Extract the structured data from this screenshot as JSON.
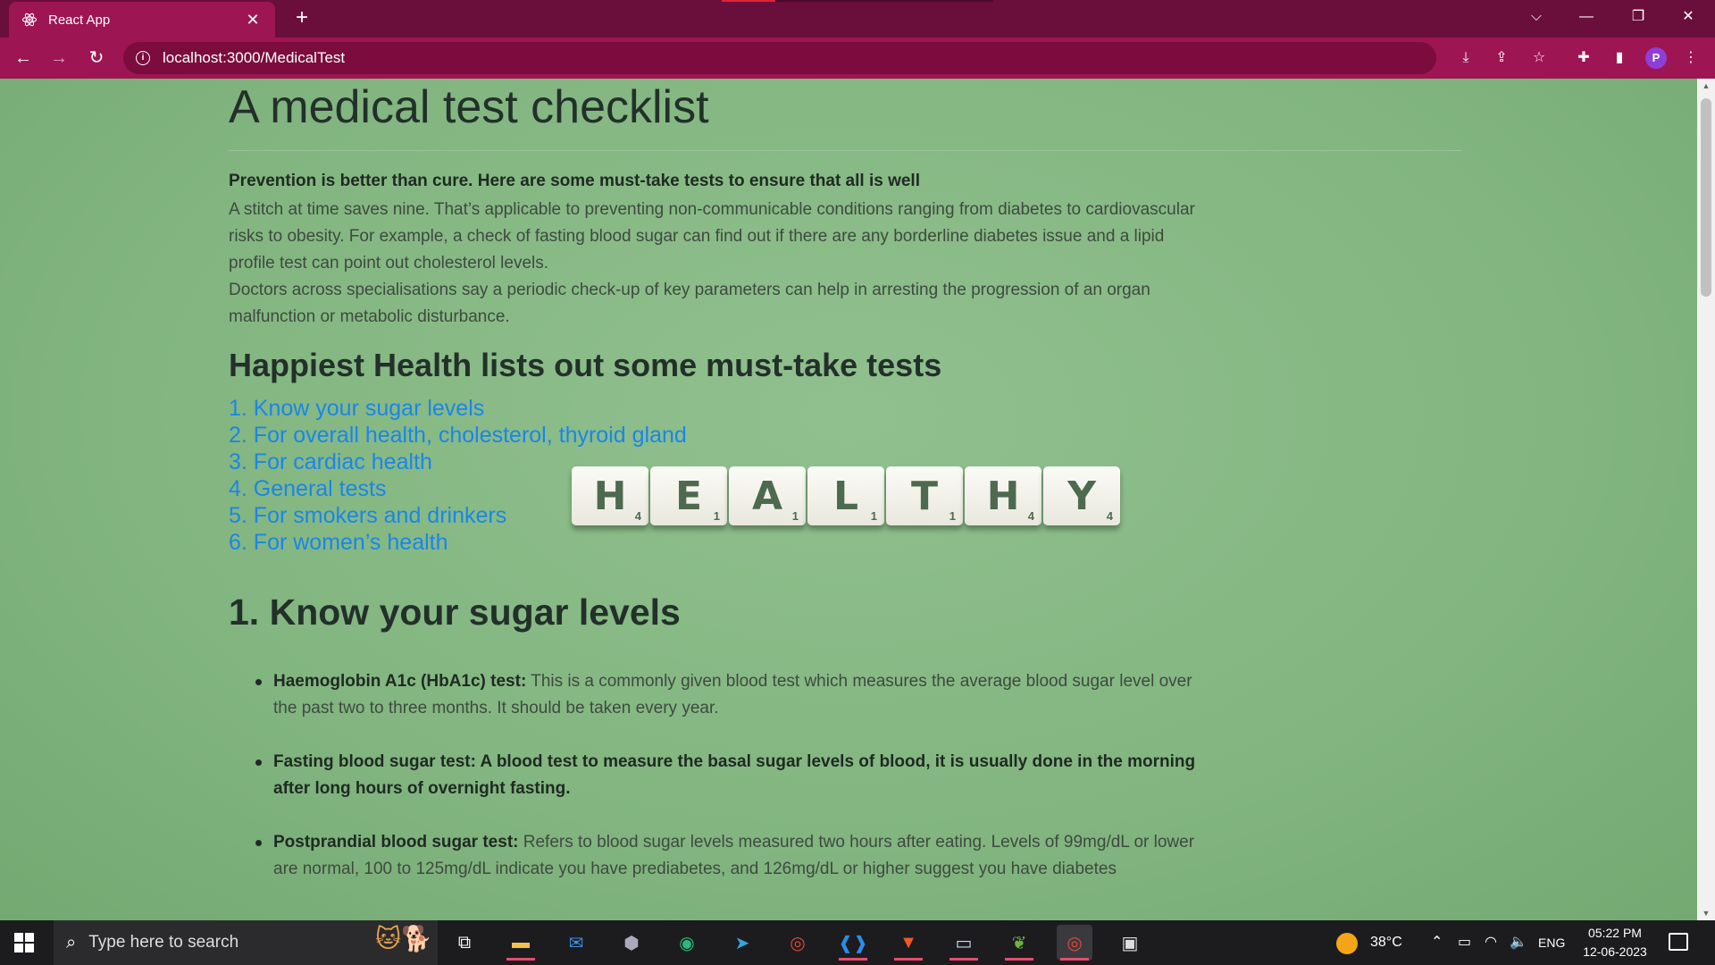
{
  "browser": {
    "tab_title": "React App",
    "url": "localhost:3000/MedicalTest",
    "profile_initial": "P"
  },
  "page": {
    "title": "A medical test checklist",
    "lead": "Prevention is better than cure. Here are some must-take tests to ensure that all is well",
    "paragraph1": "A stitch at time saves nine. That’s applicable to preventing non-communicable conditions ranging from diabetes to cardiovascular risks to obesity. For example, a check of fasting blood sugar can find out if there are any borderline diabetes issue and a lipid profile test can point out cholesterol levels.",
    "paragraph2": "Doctors across specialisations say a periodic check-up of key parameters can help in arresting the progression of an organ malfunction or metabolic disturbance.",
    "heading_brand": "Happiest Health",
    "heading_rest": " lists out some must-take tests",
    "toc": [
      "1. Know your sugar levels",
      "2. For overall health, cholesterol, thyroid gland",
      "3. For cardiac health",
      "4. General tests",
      "5. For smokers and drinkers",
      "6. For women’s health"
    ],
    "tiles": [
      {
        "letter": "H",
        "score": "4"
      },
      {
        "letter": "E",
        "score": "1"
      },
      {
        "letter": "A",
        "score": "1"
      },
      {
        "letter": "L",
        "score": "1"
      },
      {
        "letter": "T",
        "score": "1"
      },
      {
        "letter": "H",
        "score": "4"
      },
      {
        "letter": "Y",
        "score": "4"
      }
    ],
    "section1_title": "1. Know your sugar levels",
    "bullets": [
      {
        "term": "Haemoglobin A1c (HbA1c) test:",
        "text": " This is a commonly given blood test which measures the average blood sugar level over the past two to three months. It should be taken every year."
      },
      {
        "term": "Fasting blood sugar test: A blood test to measure the basal sugar levels of blood, it is usually done in the morning after long hours of overnight fasting.",
        "text": ""
      },
      {
        "term": "Postprandial blood sugar test:",
        "text": " Refers to blood sugar levels measured two hours after eating. Levels of 99mg/dL or lower are normal, 100 to 125mg/dL indicate you have prediabetes, and 126mg/dL or higher suggest you have diabetes"
      }
    ]
  },
  "taskbar": {
    "search_placeholder": "Type here to search",
    "weather": "38°C",
    "language": "ENG",
    "time": "05:22 PM",
    "date": "12-06-2023"
  },
  "colors": {
    "chrome": "#9e1553",
    "titlebar": "#6a0e3b",
    "page_bg": "#86b884",
    "link": "#1a86e8"
  }
}
